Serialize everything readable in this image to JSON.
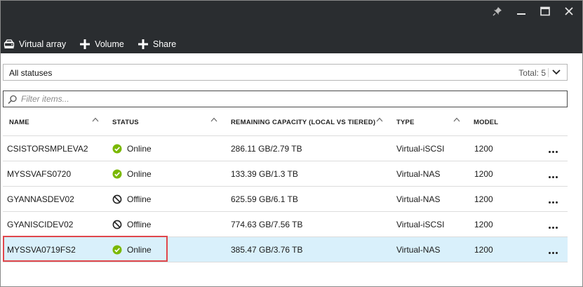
{
  "toolbar": {
    "virtual_array_label": "Virtual array",
    "volume_label": "Volume",
    "share_label": "Share"
  },
  "status_filter": {
    "selected": "All statuses",
    "total": "Total: 5"
  },
  "search": {
    "placeholder": "Filter items..."
  },
  "columns": {
    "name": "NAME",
    "status": "STATUS",
    "capacity": "REMAINING CAPACITY (LOCAL VS TIERED)",
    "type": "TYPE",
    "model": "MODEL"
  },
  "rows": [
    {
      "name": "CSISTORSMPLEVA2",
      "status": "Online",
      "status_kind": "online",
      "capacity": "286.11 GB/2.79 TB",
      "type": "Virtual-iSCSI",
      "model": "1200"
    },
    {
      "name": "MYSSVAFS0720",
      "status": "Online",
      "status_kind": "online",
      "capacity": "133.39 GB/1.3 TB",
      "type": "Virtual-NAS",
      "model": "1200"
    },
    {
      "name": "GYANNASDEV02",
      "status": "Offline",
      "status_kind": "offline",
      "capacity": "625.59 GB/6.1 TB",
      "type": "Virtual-NAS",
      "model": "1200"
    },
    {
      "name": "GYANISCIDEV02",
      "status": "Offline",
      "status_kind": "offline",
      "capacity": "774.63 GB/7.56 TB",
      "type": "Virtual-iSCSI",
      "model": "1200"
    },
    {
      "name": "MYSSVA0719FS2",
      "status": "Online",
      "status_kind": "online",
      "capacity": "385.47 GB/3.76 TB",
      "type": "Virtual-NAS",
      "model": "1200"
    }
  ],
  "colors": {
    "topbar": "#2a2d30",
    "online": "#7ab800",
    "selected_row": "#d9f0fb",
    "highlight": "#e0474c"
  },
  "icons": {
    "pin": "pin-icon",
    "maximize": "maximize-icon",
    "close": "close-icon",
    "virtual_array": "virtual-array-icon",
    "add": "plus-icon",
    "search": "search-icon",
    "online": "check-circle-icon",
    "offline": "blocked-circle-icon",
    "more": "ellipsis-icon"
  }
}
